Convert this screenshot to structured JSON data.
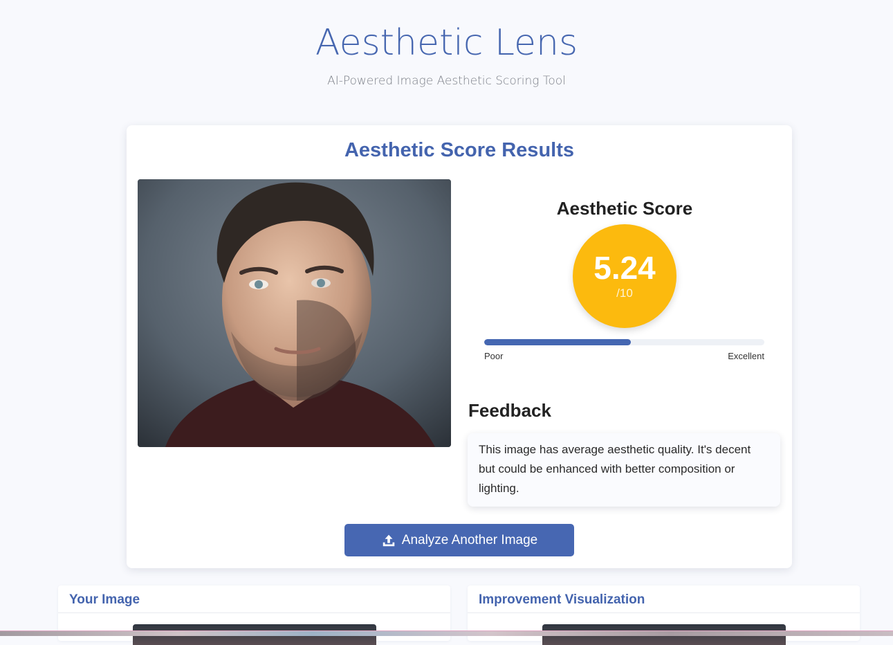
{
  "header": {
    "title": "Aesthetic Lens",
    "subtitle": "AI-Powered Image Aesthetic Scoring Tool"
  },
  "results": {
    "title": "Aesthetic Score Results",
    "score_label": "Aesthetic Score",
    "score_value": "5.24",
    "score_max": "/10",
    "score_fraction": 0.524,
    "scale_low": "Poor",
    "scale_high": "Excellent",
    "feedback_title": "Feedback",
    "feedback_text": "This image has average aesthetic quality. It's decent but could be enhanced with better composition or lighting.",
    "analyze_button": "Analyze Another Image",
    "colors": {
      "accent": "#4767b2",
      "score_circle": "#fcba0e"
    }
  },
  "panels": [
    {
      "title": "Your Image"
    },
    {
      "title": "Improvement Visualization"
    }
  ],
  "icons": {
    "analyze": "upload-icon"
  }
}
